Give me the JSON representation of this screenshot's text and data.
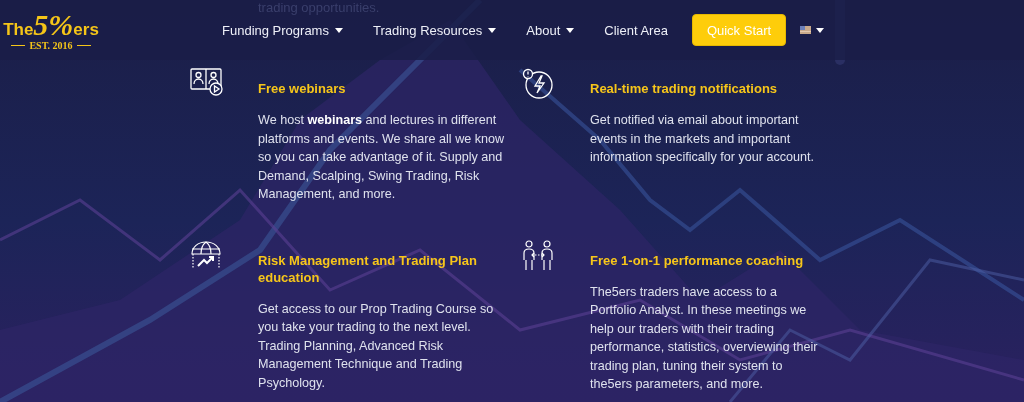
{
  "backdrop_text": "trading opportunities.",
  "logo": {
    "prefix": "The",
    "mark": "5%",
    "suffix": "ers",
    "tagline": "EST. 2016"
  },
  "nav": [
    {
      "label": "Funding Programs",
      "kind": "menu"
    },
    {
      "label": "Trading Resources",
      "kind": "menu"
    },
    {
      "label": "About",
      "kind": "menu"
    },
    {
      "label": "Client Area",
      "kind": "link"
    },
    {
      "label": "Quick Start",
      "kind": "cta"
    }
  ],
  "features": [
    {
      "title": "Free webinars",
      "text": "We host **webinars** and lectures in different platforms and events. We share all we know so you can take advantage of it. Supply and Demand, Scalping, Swing Trading, Risk Management, and more."
    },
    {
      "title": "Real-time trading notifications",
      "text": "Get notified via email about important events in the markets and important information specifically for your account."
    },
    {
      "title": "Risk Management and Trading Plan education",
      "text": "Get access to our Prop Trading Course so you take your trading to the next level. Trading Planning, Advanced Risk Management Technique and Trading Psychology."
    },
    {
      "title": "Free 1-on-1 performance coaching",
      "text": "The5ers traders have access to a Portfolio Analyst. In these meetings we help our traders with their trading performance, statistics, overviewing their trading plan, tuning their system to the5ers parameters, and more."
    }
  ]
}
